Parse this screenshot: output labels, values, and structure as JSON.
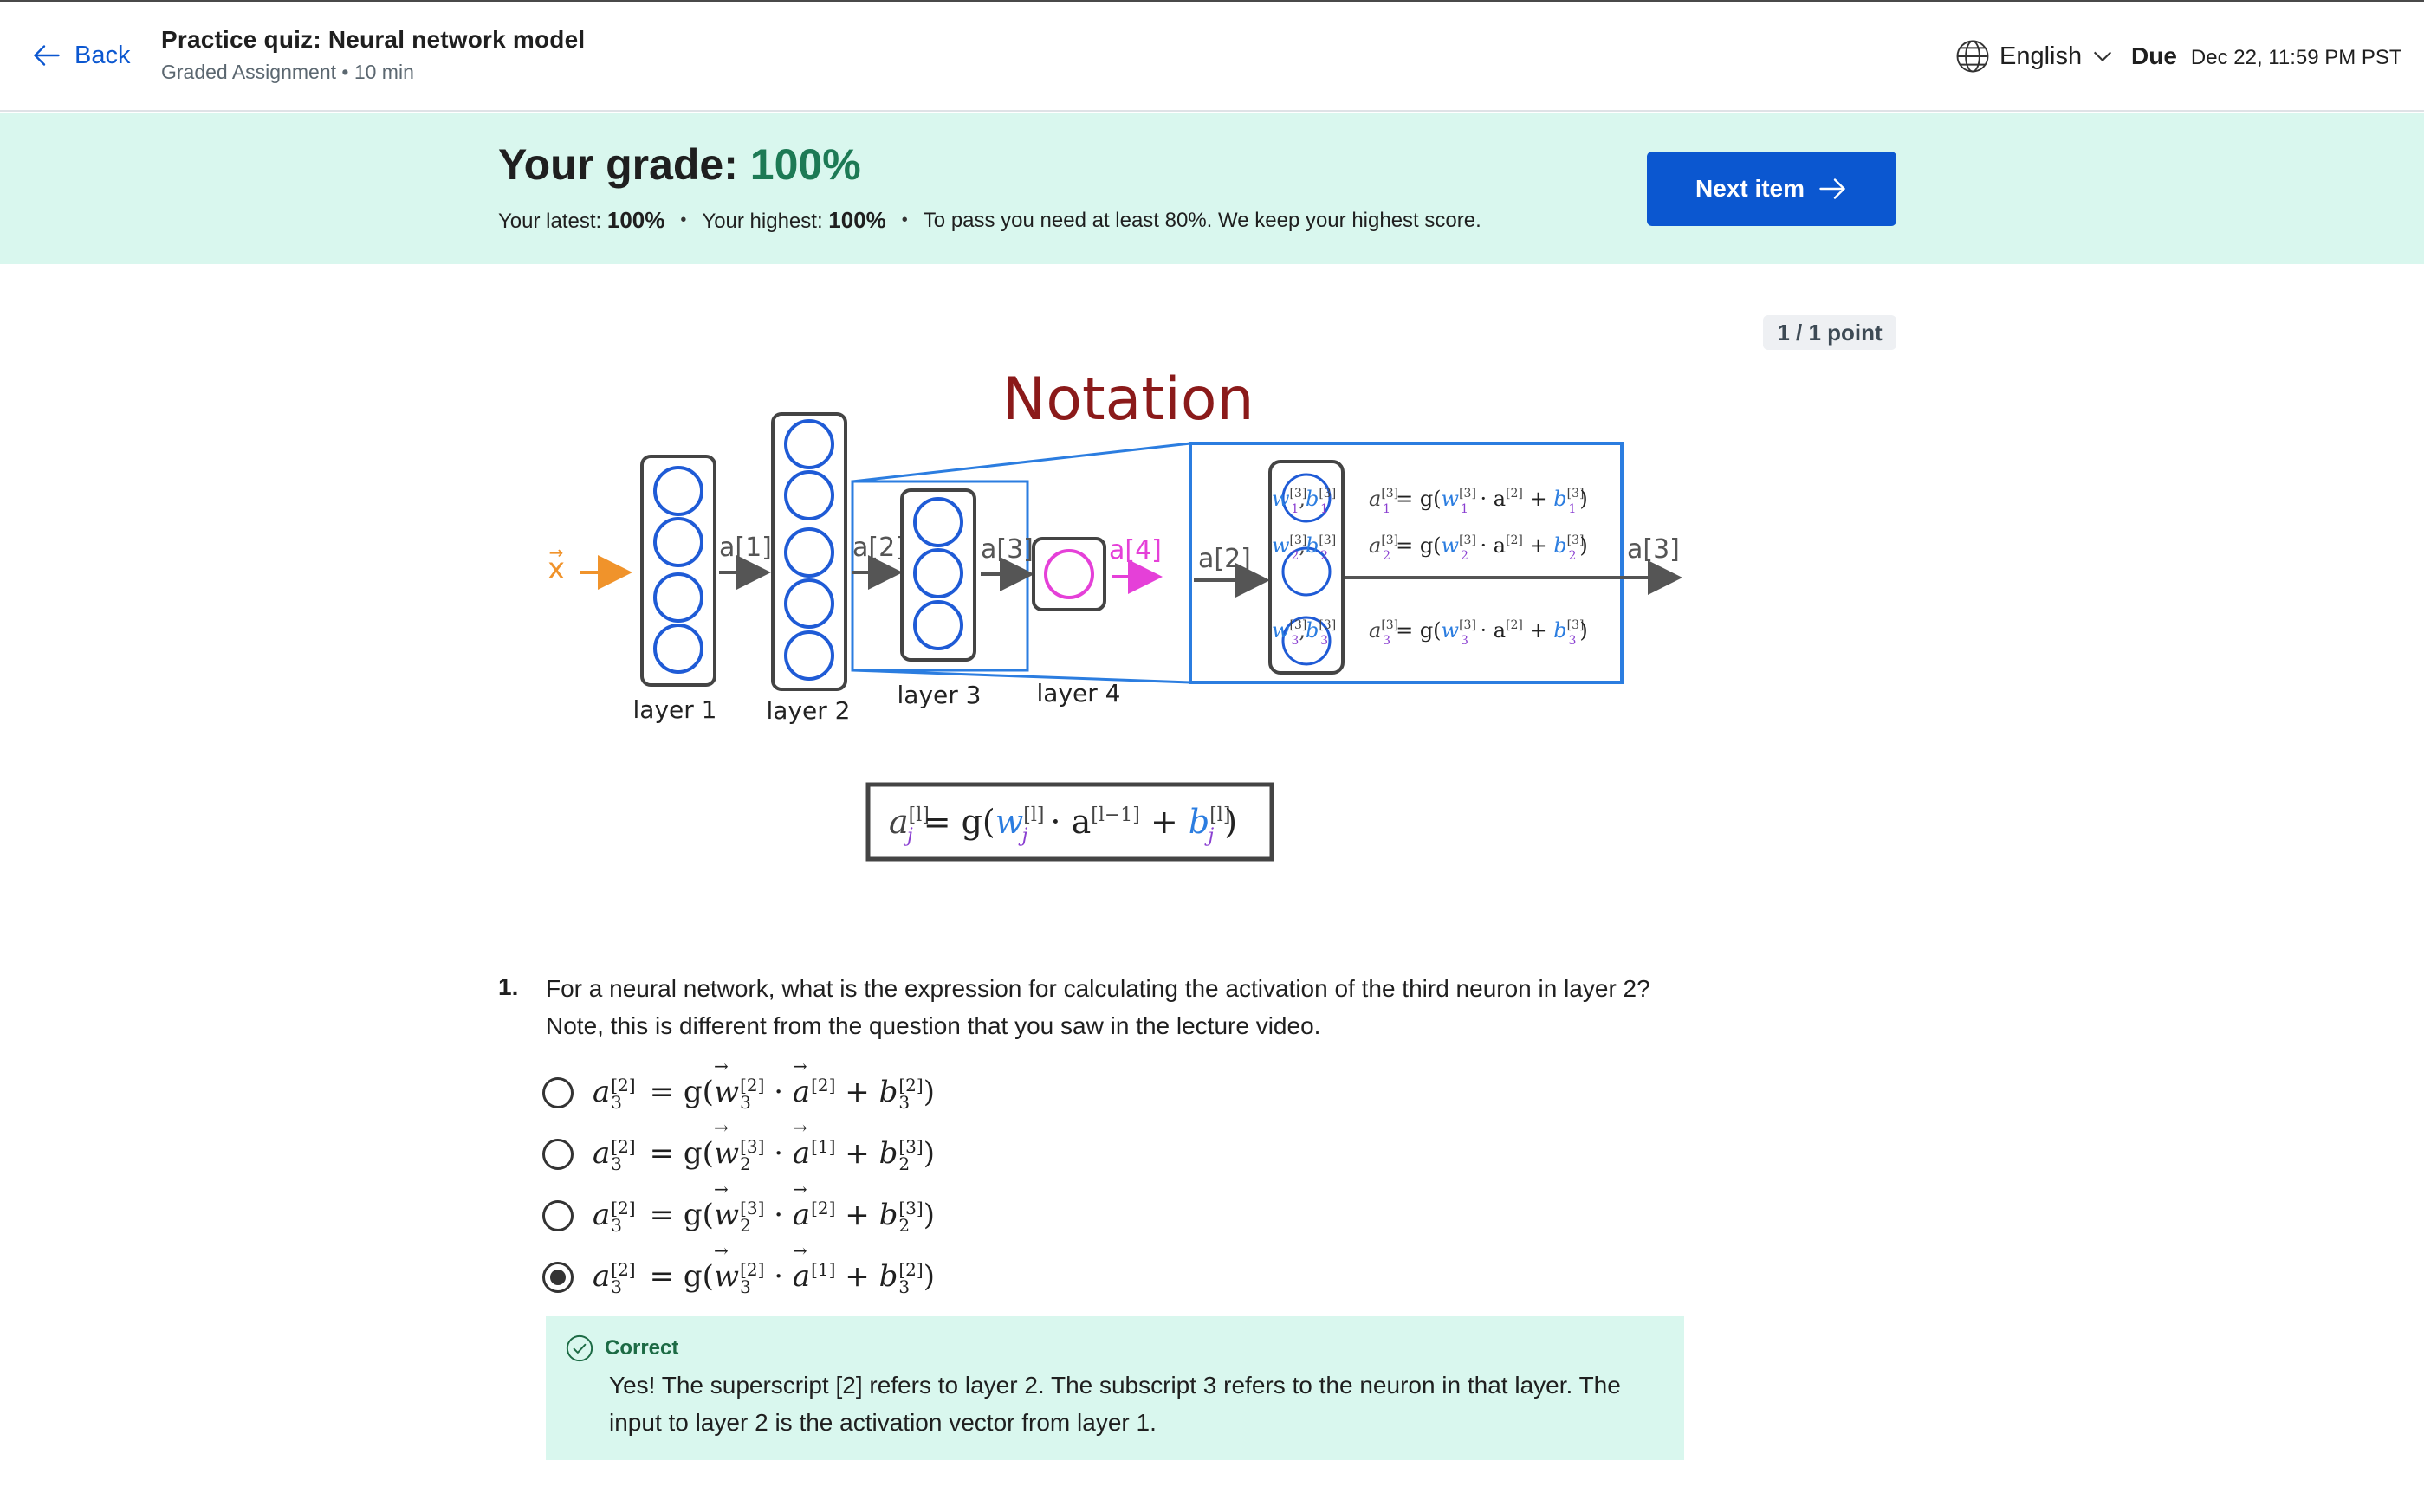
{
  "header": {
    "back_label": "Back",
    "title": "Practice quiz: Neural network model",
    "subtitle": "Graded Assignment • 10 min",
    "language": "English",
    "due_label": "Due",
    "due_value": "Dec 22, 11:59 PM PST"
  },
  "grade": {
    "label": "Your grade:",
    "value": "100%",
    "latest_label": "Your latest:",
    "latest_value": "100%",
    "highest_label": "Your highest:",
    "highest_value": "100%",
    "pass_text": "To pass you need at least 80%. We keep your highest score.",
    "next_button": "Next item"
  },
  "points": "1 / 1 point",
  "diagram": {
    "title": "Notation",
    "input": "x",
    "layer_labels": [
      "layer 1",
      "layer 2",
      "layer 3",
      "layer 4"
    ],
    "activations": [
      "a[1]",
      "a[2]",
      "a[3]",
      "a[4]"
    ],
    "zoom_input": "a[2]",
    "zoom_output": "a[3]",
    "colors": {
      "title": "#8b1a1a",
      "blue": "#2b7de0",
      "neuron": "#1f5bd6",
      "pink": "#e540d8",
      "orange": "#f0932b"
    }
  },
  "question": {
    "number": "1.",
    "text": "For a neural network, what is the expression for calculating the activation of the third neuron in layer 2? Note, this is different from the question that you saw in the lecture video.",
    "options": [
      {
        "w_sub": "3",
        "w_sup": "2",
        "a_sup": "2",
        "b_sub": "3",
        "b_sup": "2",
        "selected": false
      },
      {
        "w_sub": "2",
        "w_sup": "3",
        "a_sup": "1",
        "b_sub": "2",
        "b_sup": "3",
        "selected": false
      },
      {
        "w_sub": "2",
        "w_sup": "3",
        "a_sup": "2",
        "b_sub": "2",
        "b_sup": "3",
        "selected": false
      },
      {
        "w_sub": "3",
        "w_sup": "2",
        "a_sup": "1",
        "b_sub": "3",
        "b_sup": "2",
        "selected": true
      }
    ]
  },
  "feedback": {
    "status": "Correct",
    "text": "Yes! The superscript [2] refers to layer 2. The subscript 3 refers to the neuron in that layer. The input to layer 2 is the activation vector from layer 1."
  }
}
